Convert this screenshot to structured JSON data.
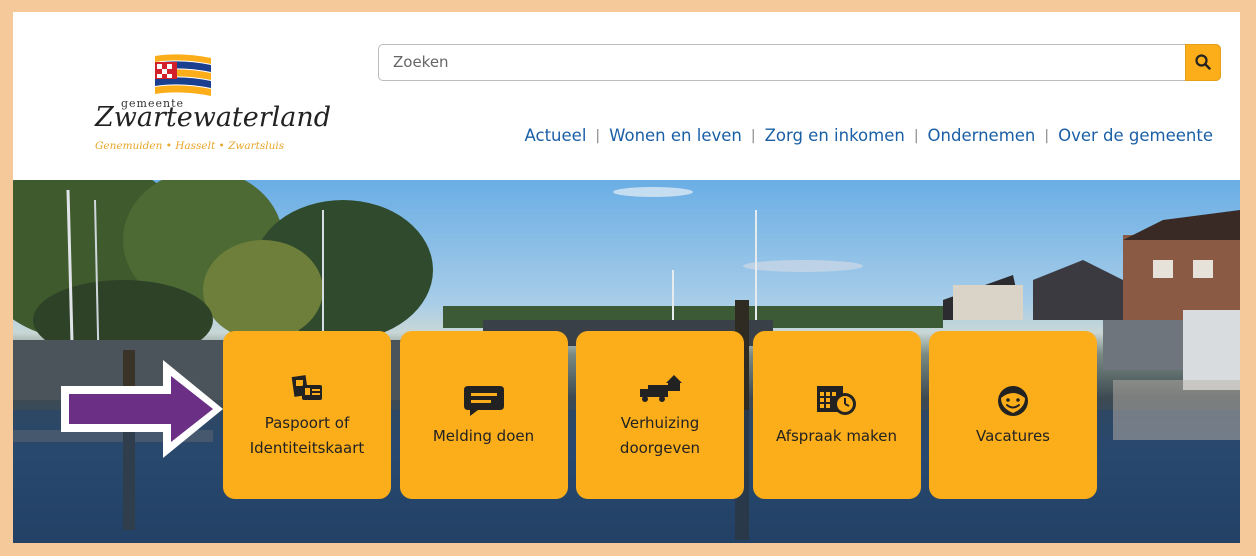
{
  "brand": {
    "small_text": "gemeente",
    "name": "Zwartewaterland",
    "tagline": "Genemuiden • Hasselt • Zwartsluis",
    "colors": {
      "yellow": "#fbad1a",
      "red": "#d2212b",
      "blue": "#1a3f8f"
    }
  },
  "search": {
    "placeholder": "Zoeken",
    "value": "",
    "button_icon": "search-icon"
  },
  "nav": {
    "items": [
      {
        "label": "Actueel"
      },
      {
        "label": "Wonen en leven"
      },
      {
        "label": "Zorg en inkomen"
      },
      {
        "label": "Ondernemen"
      },
      {
        "label": "Over de gemeente"
      }
    ],
    "separator": "|",
    "color": "#1a5fa6"
  },
  "tiles": [
    {
      "label_line1": "Paspoort of",
      "label_line2": "Identiteitskaart",
      "icon": "id-card-icon"
    },
    {
      "label_line1": "Melding doen",
      "label_line2": "",
      "icon": "speech-bubble-icon"
    },
    {
      "label_line1": "Verhuizing",
      "label_line2": "doorgeven",
      "icon": "moving-truck-icon"
    },
    {
      "label_line1": "Afspraak maken",
      "label_line2": "",
      "icon": "calendar-clock-icon"
    },
    {
      "label_line1": "Vacatures",
      "label_line2": "",
      "icon": "smiley-face-icon"
    }
  ],
  "annotation": {
    "icon": "arrow-right-icon",
    "color": "#6b2f86"
  }
}
